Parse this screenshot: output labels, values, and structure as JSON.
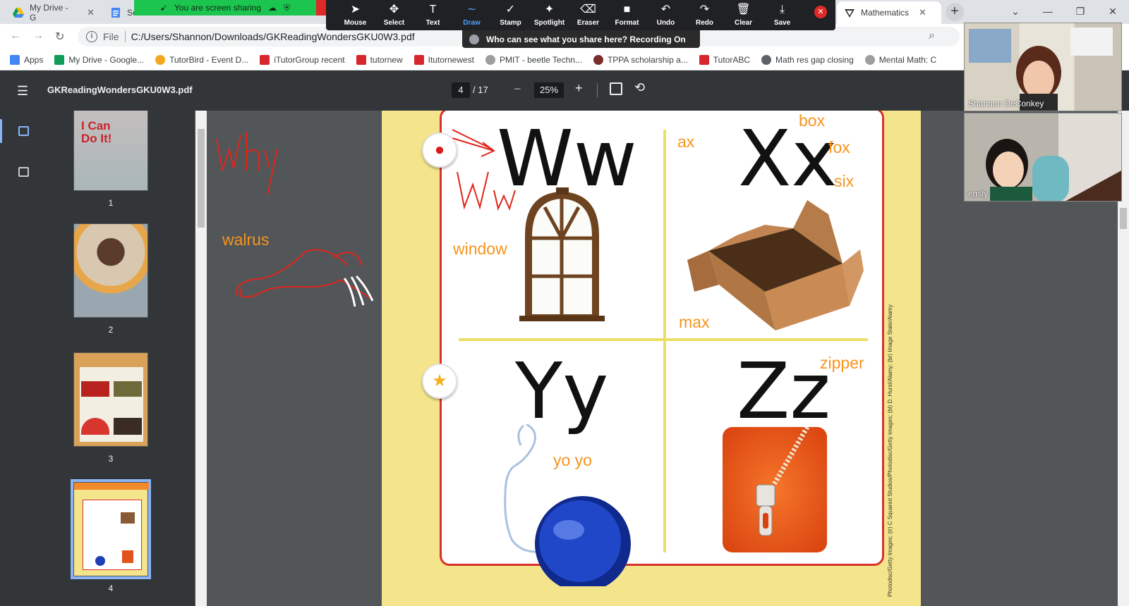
{
  "browser": {
    "tabs": [
      {
        "title": "My Drive - G",
        "icon": "google-drive-icon",
        "active": false
      },
      {
        "title": "Se",
        "icon": "google-docs-icon",
        "active": false
      },
      {
        "title": "Mathematics",
        "icon": "mathematics-site-icon",
        "active": true
      }
    ],
    "new_tab_label": "+",
    "address": {
      "scheme_label": "File",
      "url": "C:/Users/Shannon/Downloads/GKReadingWondersGKU0W3.pdf"
    },
    "bookmarks": [
      {
        "label": "Apps",
        "icon": "apps-grid-icon"
      },
      {
        "label": "My Drive - Google...",
        "icon": "google-drive-icon"
      },
      {
        "label": "TutorBird - Event D...",
        "icon": "tutorbird-icon"
      },
      {
        "label": "iTutorGroup recent",
        "icon": "itutorgroup-icon"
      },
      {
        "label": "tutornew",
        "icon": "itutorgroup-icon"
      },
      {
        "label": "Itutornewest",
        "icon": "itutorgroup-icon"
      },
      {
        "label": "PMIT - beetle Techn...",
        "icon": "globe-gray-icon"
      },
      {
        "label": "TPPA scholarship a...",
        "icon": "tppa-icon"
      },
      {
        "label": "TutorABC",
        "icon": "itutorgroup-icon"
      },
      {
        "label": "Math res gap closing",
        "icon": "globe-icon"
      },
      {
        "label": "Mental Math: C",
        "icon": "globe-gray-icon"
      }
    ]
  },
  "sharing": {
    "banner_text": "You are screen sharing",
    "who_can_see": "Who can see what you share here? Recording On"
  },
  "annotation_toolbar": {
    "tools": [
      {
        "label": "Mouse",
        "icon": "mouse-pointer-icon",
        "glyph": "➤",
        "active": false
      },
      {
        "label": "Select",
        "icon": "move-arrows-icon",
        "glyph": "✥",
        "active": false
      },
      {
        "label": "Text",
        "icon": "text-icon",
        "glyph": "T",
        "active": false
      },
      {
        "label": "Draw",
        "icon": "draw-squiggle-icon",
        "glyph": "∼",
        "active": true
      },
      {
        "label": "Stamp",
        "icon": "stamp-check-icon",
        "glyph": "✓",
        "active": false
      },
      {
        "label": "Spotlight",
        "icon": "spotlight-wand-icon",
        "glyph": "✦",
        "active": false
      },
      {
        "label": "Eraser",
        "icon": "eraser-icon",
        "glyph": "⌫",
        "active": false
      },
      {
        "label": "Format",
        "icon": "format-square-icon",
        "glyph": "■",
        "active": false
      },
      {
        "label": "Undo",
        "icon": "undo-icon",
        "glyph": "↶",
        "active": false
      },
      {
        "label": "Redo",
        "icon": "redo-icon",
        "glyph": "↷",
        "active": false
      },
      {
        "label": "Clear",
        "icon": "trash-icon",
        "glyph": "🗑",
        "active": false
      },
      {
        "label": "Save",
        "icon": "save-download-icon",
        "glyph": "⤓",
        "active": false
      }
    ]
  },
  "pdf_viewer": {
    "file_name": "GKReadingWondersGKU0W3.pdf",
    "current_page": "4",
    "total_pages": "/ 17",
    "zoom": "25%",
    "thumbnails": [
      {
        "page": "1",
        "title": "I Can Do It!",
        "selected": false
      },
      {
        "page": "2",
        "selected": false
      },
      {
        "page": "3",
        "selected": false
      },
      {
        "page": "4",
        "selected": true
      }
    ]
  },
  "page_content": {
    "letters": [
      "Ww",
      "Xx",
      "Yy",
      "Zz"
    ],
    "annotations": {
      "why": "Why",
      "walrus": "walrus",
      "ww_handwritten": "Ww",
      "window": "window",
      "ax": "ax",
      "box": "box",
      "fox": "fox",
      "six": "six",
      "max": "max",
      "yo_yo": "yo yo",
      "zipper": "zipper"
    },
    "photo_credit": "Photodisc/Getty Images; (tr) C Squared Studios/Photodisc/Getty Images; (bl) D. Hurst/Alamy; (br) Image State/Alamy",
    "colors": {
      "annotation_orange": "#f7941d",
      "annotation_red": "#e0251b",
      "card_border": "#d9312b",
      "page_bg": "#f4e48c"
    }
  },
  "participants": [
    {
      "name": "Shannon DeConkey"
    },
    {
      "name": "emily"
    }
  ]
}
